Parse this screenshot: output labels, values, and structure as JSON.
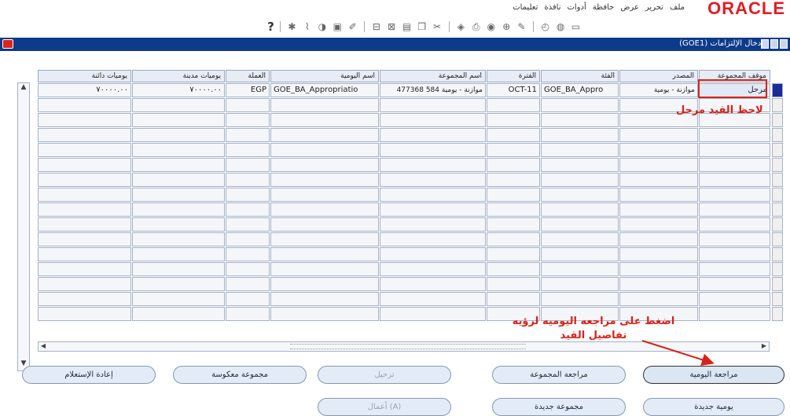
{
  "app": {
    "logo": "ORACLE",
    "menus": [
      "ملف",
      "تحرير",
      "عرض",
      "حافظة",
      "أدوات",
      "نافذة",
      "تعليمات"
    ]
  },
  "window": {
    "title": "إدخال الإلتزامات (GOE1)"
  },
  "grid": {
    "headers": {
      "status": "موقف المجموعة",
      "source": "المصدر",
      "category": "الفئة",
      "period": "الفترة",
      "batch_name": "اسم المجموعة",
      "journal_name": "اسم اليومية",
      "currency": "العملة",
      "entered_debits": "يوميات مدينة",
      "entered_credits": "يوميات دائنة"
    },
    "rows": [
      {
        "status": "مرحل",
        "source": "موازنة - يومية",
        "category": "GOE_BA_Appro",
        "period": "OCT-11",
        "batch_name": "موازنة - يومية 584 477368",
        "journal_name": "GOE_BA_Appropriatio",
        "currency": "EGP",
        "entered_debits": "٧٠٠٠٠.٠٠",
        "entered_credits": "٧٠٠٠٠.٠٠"
      }
    ],
    "empty_row_count": 15
  },
  "annotations": {
    "note_posted": "لاحظ القيد مرحل",
    "note_review": "اضغط على مراجعه اليوميه لرؤيه تفاصيل القيد"
  },
  "buttons": {
    "review_journal": "مراجعة اليومية",
    "review_batch": "مراجعة المجموعة",
    "post": "ترحيل",
    "reverse_batch": "مجموعة معكوسة",
    "requery": "إعادة الإستعلام",
    "new_journal": "يومية جديدة",
    "new_batch": "مجموعة جديدة",
    "more_actions": "أعمال (A)"
  }
}
